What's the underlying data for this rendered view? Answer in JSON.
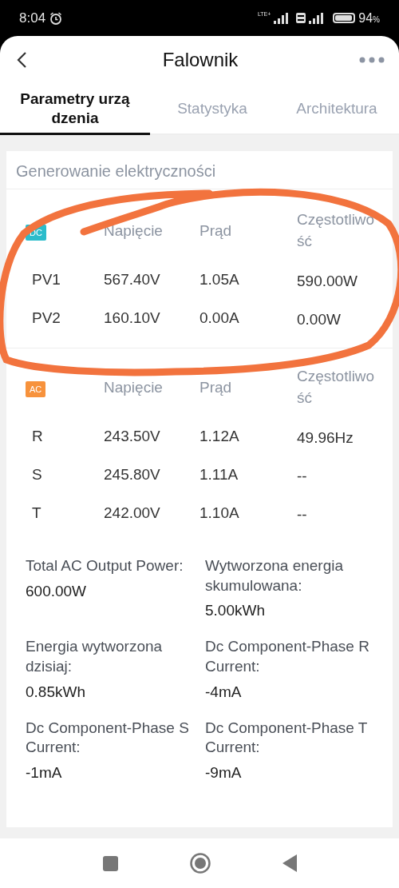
{
  "status_bar": {
    "time": "8:04",
    "network": "LTE+",
    "battery": "94",
    "battery_unit": "%"
  },
  "header": {
    "title": "Falownik"
  },
  "tabs": [
    {
      "label": "Parametry urządzenia",
      "selected": true
    },
    {
      "label": "Statystyka",
      "selected": false
    },
    {
      "label": "Architektura",
      "selected": false
    }
  ],
  "card": {
    "title": "Generowanie elektryczności",
    "tables": [
      {
        "color": "#2bbccb",
        "columns": [
          "DC",
          "Napięcie",
          "Prąd",
          "Częstotliwość"
        ],
        "rows": [
          [
            "PV1",
            "567.40V",
            "1.05A",
            "590.00W"
          ],
          [
            "PV2",
            "160.10V",
            "0.00A",
            "0.00W"
          ]
        ]
      },
      {
        "color": "#f7923c",
        "columns": [
          "AC",
          "Napięcie",
          "Prąd",
          "Częstotliwość"
        ],
        "rows": [
          [
            "R",
            "243.50V",
            "1.12A",
            "49.96Hz"
          ],
          [
            "S",
            "245.80V",
            "1.11A",
            "--"
          ],
          [
            "T",
            "242.00V",
            "1.10A",
            "--"
          ]
        ]
      }
    ],
    "stats": [
      {
        "label": "Total AC Output Power:",
        "value": "600.00W"
      },
      {
        "label": "Wytworzona energia skumulowana:",
        "value": "5.00kWh"
      },
      {
        "label": "Energia wytworzona dzisiaj:",
        "value": "0.85kWh"
      },
      {
        "label": "Dc Component-Phase R Current:",
        "value": "-4mA"
      },
      {
        "label": "Dc Component-Phase S Current:",
        "value": "-1mA"
      },
      {
        "label": "Dc Component-Phase T Current:",
        "value": "-9mA"
      }
    ]
  },
  "annotation": {
    "kind": "circle"
  }
}
